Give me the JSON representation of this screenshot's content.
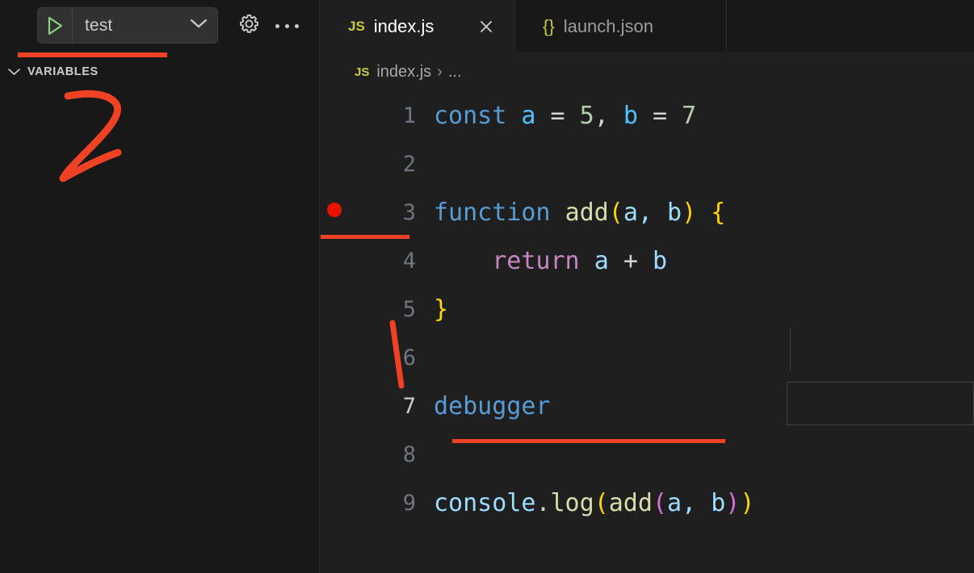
{
  "sidebar": {
    "debug_toolbar": {
      "play_icon": "play-triangle-icon",
      "config_label": "test",
      "chevron_icon": "chevron-down-icon",
      "gear_icon": "gear-icon",
      "more_icon": "ellipsis-icon"
    },
    "section": {
      "chevron_icon": "chevron-down-icon",
      "title": "VARIABLES"
    }
  },
  "editor": {
    "tabs": [
      {
        "icon": "js-file-icon",
        "icon_glyph": "JS",
        "label": "index.js",
        "active": true,
        "close_icon": "close-icon"
      },
      {
        "icon": "json-file-icon",
        "icon_glyph": "{}",
        "label": "launch.json",
        "active": false
      }
    ],
    "breadcrumb": {
      "icon": "js-file-icon",
      "icon_glyph": "JS",
      "file": "index.js",
      "separator": "›",
      "tail": "..."
    },
    "gutter": {
      "breakpoint_icon": "breakpoint-dot-icon",
      "breakpoint_line": 3,
      "active_line": 7
    },
    "lines": [
      {
        "n": "1",
        "text": "const a = 5, b = 7"
      },
      {
        "n": "2",
        "text": ""
      },
      {
        "n": "3",
        "text": "function add(a, b) {"
      },
      {
        "n": "4",
        "text": "    return a + b"
      },
      {
        "n": "5",
        "text": "}"
      },
      {
        "n": "6",
        "text": ""
      },
      {
        "n": "7",
        "text": "debugger"
      },
      {
        "n": "8",
        "text": ""
      },
      {
        "n": "9",
        "text": "console.log(add(a, b))"
      }
    ]
  },
  "annotations": {
    "color": "#ef4123",
    "marks": [
      {
        "name": "underline-variables-panel",
        "kind": "underline"
      },
      {
        "name": "handwritten-step-number",
        "kind": "digit",
        "value": "2"
      },
      {
        "name": "underline-breakpoint-gutter",
        "kind": "underline"
      },
      {
        "name": "slash-near-line-6",
        "kind": "stroke"
      },
      {
        "name": "underline-below-debugger-line",
        "kind": "underline"
      }
    ]
  },
  "theme": {
    "sidebar_bg": "#181818",
    "editor_bg": "#1f1f1f",
    "accent_red": "#ef4123",
    "breakpoint_red": "#e51400",
    "keyword_blue": "#569cd6",
    "variable_blue": "#4fc1ff",
    "number_green": "#b5cea8",
    "function_yellow": "#dcdcaa",
    "bracket_gold": "#ffd602",
    "bracket_pink": "#da70d6",
    "return_purple": "#c586c0"
  }
}
